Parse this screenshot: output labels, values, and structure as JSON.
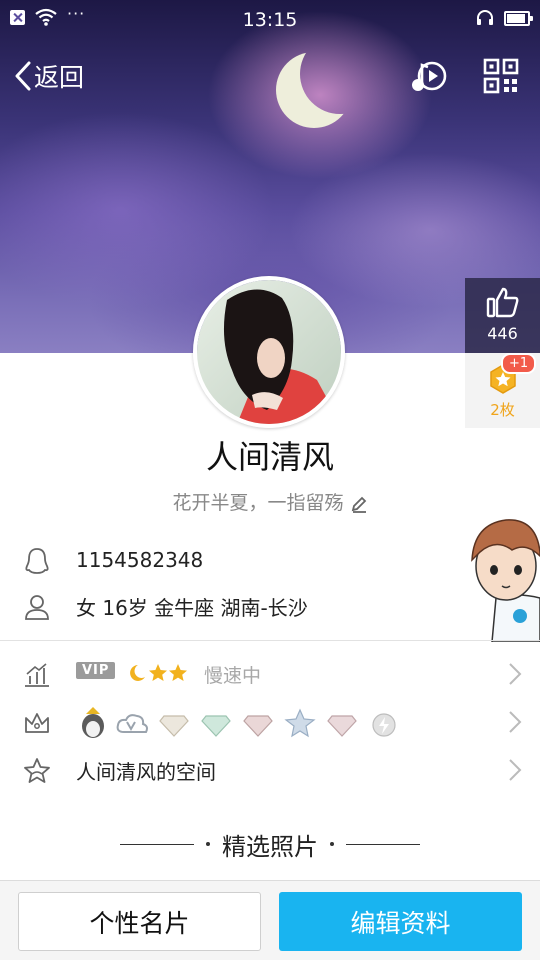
{
  "status_bar": {
    "time": "13:15",
    "dots": "···"
  },
  "nav": {
    "back_label": "返回"
  },
  "likes": {
    "count": "446",
    "badge": "+1",
    "medal_count": "2枚"
  },
  "profile": {
    "nickname": "人间清风",
    "signature": "花开半夏，一指留殇",
    "qq_number": "1154582348",
    "details": "女  16岁  金牛座  湖南-长沙"
  },
  "rows": {
    "level_vip": "VIP",
    "level_status": "慢速中",
    "space_label": "人间清风的空间"
  },
  "section": {
    "photos_title": "精选照片"
  },
  "buttons": {
    "card_label": "个性名片",
    "edit_label": "编辑资料"
  },
  "colors": {
    "accent": "#19b4f0",
    "badge_red": "#f25b4a",
    "medal_gold": "#f0a51c"
  }
}
